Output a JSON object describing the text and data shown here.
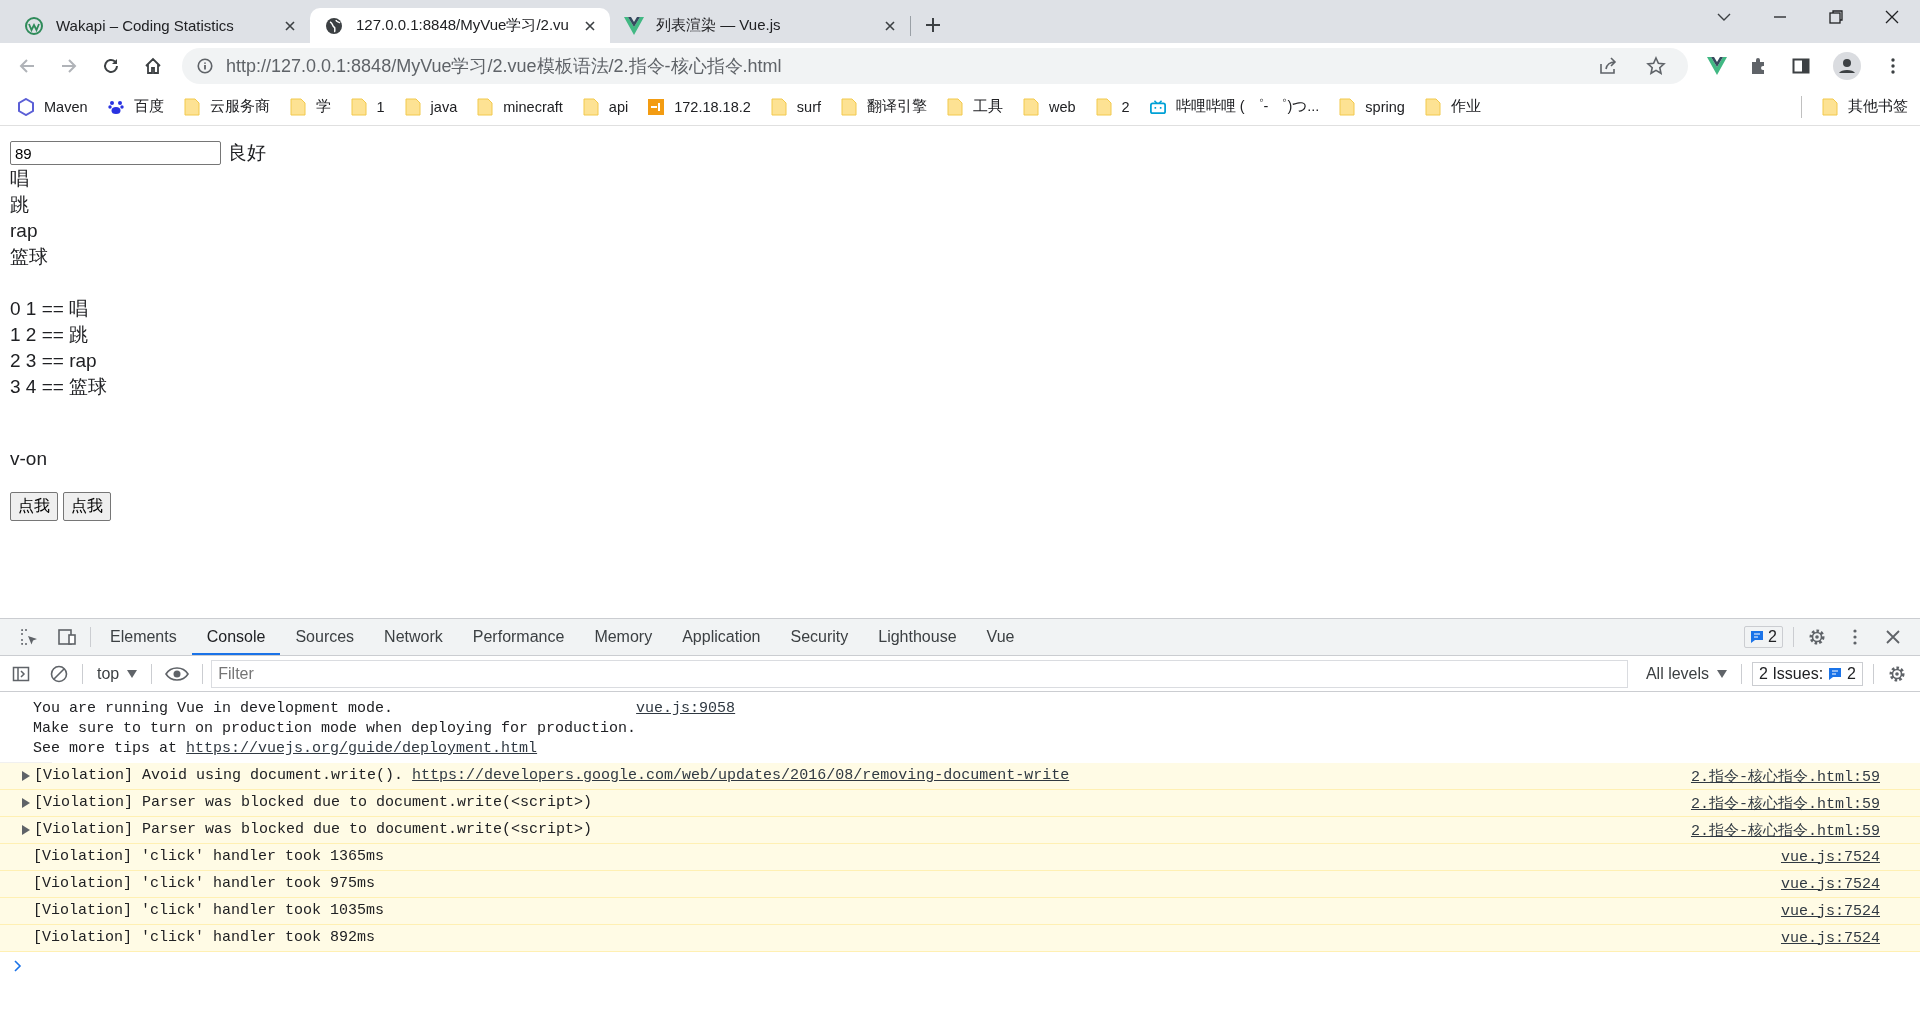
{
  "browser": {
    "tabs": [
      {
        "title": "Wakapi – Coding Statistics",
        "selected": false
      },
      {
        "title": "127.0.0.1:8848/MyVue学习/2.vu",
        "selected": true
      },
      {
        "title": "列表渲染 — Vue.js",
        "selected": false
      }
    ],
    "address": "http://127.0.0.1:8848/MyVue学习/2.vue模板语法/2.指令-核心指令.html",
    "bookmarks": [
      {
        "label": "Maven",
        "kind": "site"
      },
      {
        "label": "百度",
        "kind": "site"
      },
      {
        "label": "云服务商",
        "kind": "folder"
      },
      {
        "label": "学",
        "kind": "folder"
      },
      {
        "label": "1",
        "kind": "folder"
      },
      {
        "label": "java",
        "kind": "folder"
      },
      {
        "label": "minecraft",
        "kind": "folder"
      },
      {
        "label": "api",
        "kind": "folder"
      },
      {
        "label": "172.18.18.2",
        "kind": "site"
      },
      {
        "label": "surf",
        "kind": "folder"
      },
      {
        "label": "翻译引擎",
        "kind": "folder"
      },
      {
        "label": "工具",
        "kind": "folder"
      },
      {
        "label": "web",
        "kind": "folder"
      },
      {
        "label": "2",
        "kind": "folder"
      },
      {
        "label": "哔哩哔哩 ( ゜- ゜)つ...",
        "kind": "site"
      },
      {
        "label": "spring",
        "kind": "folder"
      },
      {
        "label": "作业",
        "kind": "folder"
      }
    ],
    "other_bookmarks": "其他书签"
  },
  "page": {
    "score_input": "89",
    "grade": "良好",
    "hobbies": [
      "唱",
      "跳",
      "rap",
      "篮球"
    ],
    "indexed_hobbies": [
      "0 1 == 唱",
      "1 2 == 跳",
      "2 3 == rap",
      "3 4 == 篮球"
    ],
    "heading": "v-on",
    "buttons": [
      "点我",
      "点我"
    ]
  },
  "devtools": {
    "tabs": [
      {
        "label": "Elements",
        "selected": false
      },
      {
        "label": "Console",
        "selected": true
      },
      {
        "label": "Sources",
        "selected": false
      },
      {
        "label": "Network",
        "selected": false
      },
      {
        "label": "Performance",
        "selected": false
      },
      {
        "label": "Memory",
        "selected": false
      },
      {
        "label": "Application",
        "selected": false
      },
      {
        "label": "Security",
        "selected": false
      },
      {
        "label": "Lighthouse",
        "selected": false
      },
      {
        "label": "Vue",
        "selected": false
      }
    ],
    "message_count": "2",
    "context": "top",
    "filter_placeholder": "Filter",
    "levels": "All levels",
    "issues_label": "2 Issues:",
    "issues_count": "2",
    "messages": [
      {
        "kind": "info",
        "expandable": false,
        "lines": [
          "You are running Vue in development mode.",
          "Make sure to turn on production mode when deploying for production."
        ],
        "text": "See more tips at ",
        "link": "https://vuejs.org/guide/deployment.html",
        "source": "vue.js:9058"
      },
      {
        "kind": "violation",
        "expandable": true,
        "text": "[Violation] Avoid using document.write(). ",
        "link": "https://developers.google.com/web/updates/2016/08/removing-document-write",
        "source": "2.指令-核心指令.html:59"
      },
      {
        "kind": "violation",
        "expandable": true,
        "text": "[Violation] Parser was blocked due to document.write(<script>)",
        "source": "2.指令-核心指令.html:59"
      },
      {
        "kind": "violation",
        "expandable": true,
        "text": "[Violation] Parser was blocked due to document.write(<script>)",
        "source": "2.指令-核心指令.html:59"
      },
      {
        "kind": "violation",
        "expandable": false,
        "text": "[Violation] 'click' handler took 1365ms",
        "source": "vue.js:7524"
      },
      {
        "kind": "violation",
        "expandable": false,
        "text": "[Violation] 'click' handler took 975ms",
        "source": "vue.js:7524"
      },
      {
        "kind": "violation",
        "expandable": false,
        "text": "[Violation] 'click' handler took 1035ms",
        "source": "vue.js:7524"
      },
      {
        "kind": "violation",
        "expandable": false,
        "text": "[Violation] 'click' handler took 892ms",
        "source": "vue.js:7524"
      }
    ]
  }
}
